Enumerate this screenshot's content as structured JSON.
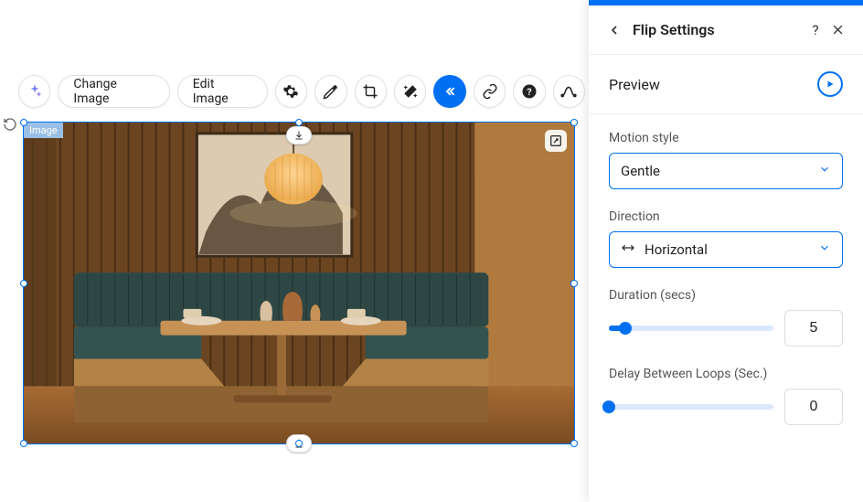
{
  "selection_label": "Image",
  "toolbar": {
    "change_image": "Change Image",
    "edit_image": "Edit Image"
  },
  "panel": {
    "title": "Flip Settings",
    "preview_label": "Preview",
    "motion_style": {
      "label": "Motion style",
      "value": "Gentle"
    },
    "direction": {
      "label": "Direction",
      "value": "Horizontal"
    },
    "duration": {
      "label": "Duration (secs)",
      "value": "5",
      "percent": 10
    },
    "delay": {
      "label": "Delay Between Loops (Sec.)",
      "value": "0",
      "percent": 0
    }
  }
}
